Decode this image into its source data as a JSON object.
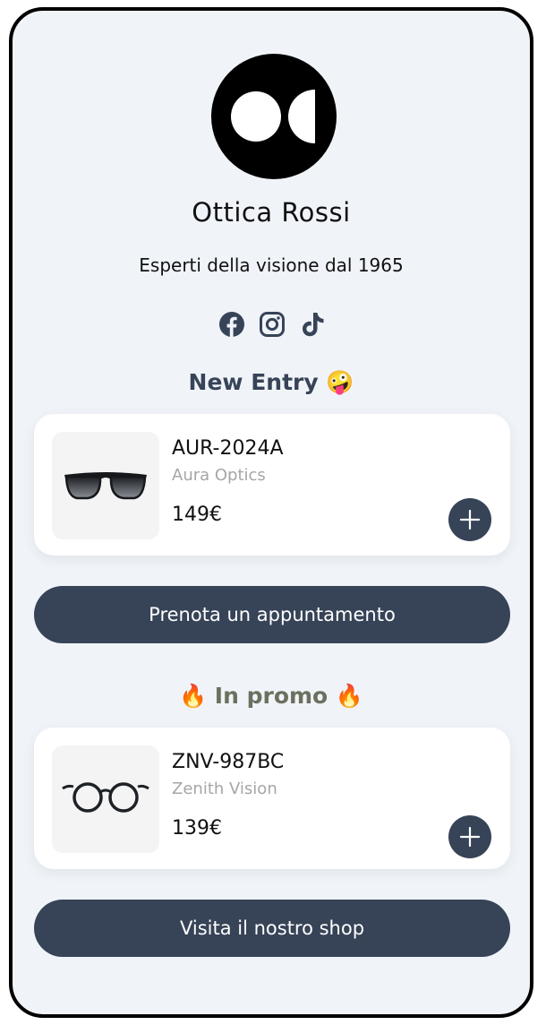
{
  "profile": {
    "name": "Ottica Rossi",
    "tagline": "Esperti della visione dal 1965"
  },
  "socials": [
    {
      "icon": "facebook-icon"
    },
    {
      "icon": "instagram-icon"
    },
    {
      "icon": "tiktok-icon"
    }
  ],
  "sections": {
    "new_entry": {
      "title": "New Entry 🤪"
    },
    "promo": {
      "title": "🔥 In promo 🔥"
    }
  },
  "products": [
    {
      "code": "AUR-2024A",
      "brand": "Aura Optics",
      "price": "149€",
      "image": "sunglasses-image"
    },
    {
      "code": "ZNV-987BC",
      "brand": "Zenith Vision",
      "price": "139€",
      "image": "round-eyeglasses-image"
    }
  ],
  "buttons": {
    "appointment": "Prenota un appuntamento",
    "shop": "Visita il nostro shop"
  },
  "colors": {
    "accent": "#374357",
    "background": "#f0f4f9",
    "promo_title": "#6b705f"
  }
}
